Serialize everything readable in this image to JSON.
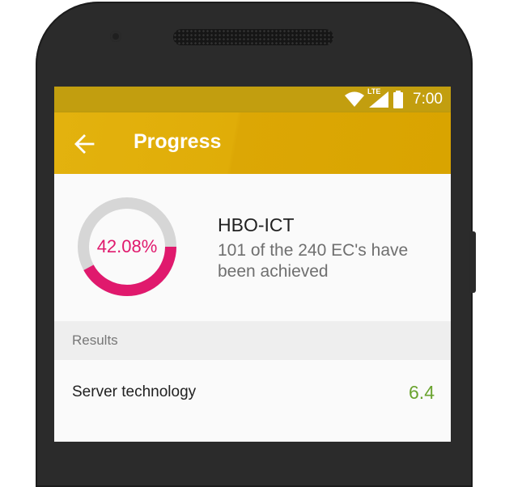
{
  "status_bar": {
    "time": "7:00",
    "network_label": "LTE",
    "icons": [
      "wifi-icon",
      "signal-icon",
      "battery-icon"
    ]
  },
  "app_bar": {
    "title": "Progress",
    "back_icon": "arrow-left-icon"
  },
  "progress": {
    "percent_label": "42.08%",
    "percent_value": 42.08,
    "degree": "HBO-ICT",
    "description": "101 of the 240 EC's have been achieved"
  },
  "results": {
    "header": "Results",
    "items": [
      {
        "name": "Server technology",
        "grade": "6.4"
      }
    ]
  },
  "colors": {
    "accent_pink": "#e0196d",
    "ring_track": "#d6d6d6",
    "app_bar": "#dca705",
    "status_bar": "#c29e0f",
    "grade_green": "#6aa32f"
  }
}
